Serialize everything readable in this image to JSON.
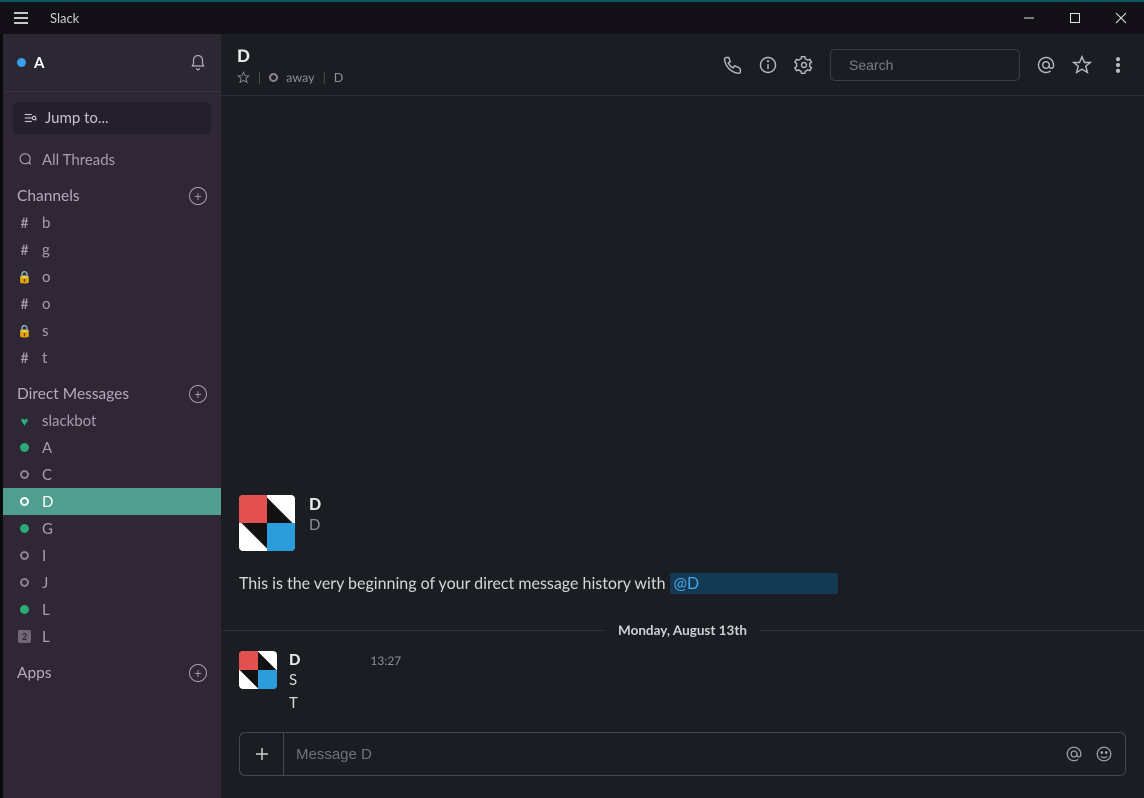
{
  "titlebar": {
    "app_name": "Slack"
  },
  "workspace": {
    "name": "A",
    "presence": "online"
  },
  "sidebar": {
    "jump_label": "Jump to...",
    "all_threads": "All Threads",
    "channels_header": "Channels",
    "channels": [
      {
        "type": "hash",
        "name": "b"
      },
      {
        "type": "hash",
        "name": "g"
      },
      {
        "type": "lock",
        "name": "o"
      },
      {
        "type": "hash",
        "name": "o"
      },
      {
        "type": "lock",
        "name": "s"
      },
      {
        "type": "hash",
        "name": "t"
      }
    ],
    "dms_header": "Direct Messages",
    "dms": [
      {
        "icon": "heart",
        "name": "slackbot",
        "selected": false
      },
      {
        "icon": "green",
        "name": "A",
        "selected": false
      },
      {
        "icon": "away",
        "name": "C",
        "selected": false
      },
      {
        "icon": "away",
        "name": "D",
        "selected": true
      },
      {
        "icon": "green",
        "name": "G",
        "selected": false
      },
      {
        "icon": "away",
        "name": "I",
        "selected": false
      },
      {
        "icon": "away",
        "name": "J",
        "selected": false
      },
      {
        "icon": "green",
        "name": "L",
        "selected": false
      },
      {
        "icon": "square",
        "name": "L",
        "selected": false
      }
    ],
    "apps_header": "Apps"
  },
  "header": {
    "title": "D",
    "status_text": "away",
    "subject": "D",
    "search_placeholder": "Search"
  },
  "intro": {
    "name": "D",
    "subtitle": "D",
    "text_prefix": "This is the very beginning of your direct message history with ",
    "mention": "@D"
  },
  "divider": {
    "label": "Monday, August 13th"
  },
  "messages": [
    {
      "author": "D",
      "time": "13:27",
      "lines": [
        "S",
        "T"
      ]
    }
  ],
  "composer": {
    "placeholder": "Message D"
  }
}
